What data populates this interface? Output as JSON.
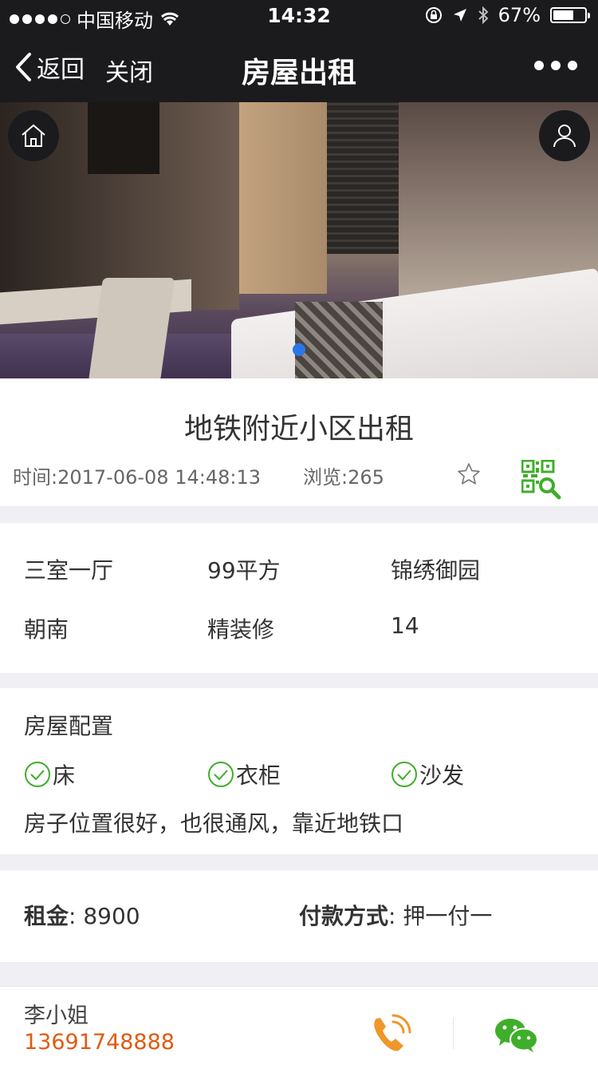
{
  "status_bar": {
    "carrier": "中国移动",
    "time": "14:32",
    "battery": "67%",
    "battery_level": 0.67
  },
  "nav": {
    "back_label": "返回",
    "close_label": "关闭",
    "title": "房屋出租"
  },
  "carousel": {
    "slide_count": 1,
    "active_index": 0
  },
  "post": {
    "title": "地铁附近小区出租",
    "time_label": "时间:",
    "time_value": "2017-06-08 14:48:13",
    "views_label": "浏览:",
    "views_value": "265"
  },
  "specs": [
    "三室一厅",
    "99平方",
    "锦绣御园",
    "朝南",
    "精装修",
    "14"
  ],
  "config": {
    "heading": "房屋配置",
    "amenities": [
      "床",
      "衣柜",
      "沙发"
    ],
    "description": "房子位置很好，也很通风，靠近地铁口"
  },
  "rent": {
    "price_label": "租金",
    "price_value": "8900",
    "payment_label": "付款方式",
    "payment_value": "押一付一"
  },
  "contact": {
    "name": "李小姐",
    "phone": "13691748888"
  },
  "colors": {
    "nav_bg": "#1b1b1d",
    "check_green": "#3fae2a",
    "phone_orange": "#e05a12",
    "carousel_dot": "#2a76e8"
  },
  "icons": [
    "back-chevron-icon",
    "more-icon",
    "home-icon",
    "user-icon",
    "star-icon",
    "qr-search-icon",
    "check-circle-icon",
    "phone-icon",
    "wechat-icon"
  ]
}
